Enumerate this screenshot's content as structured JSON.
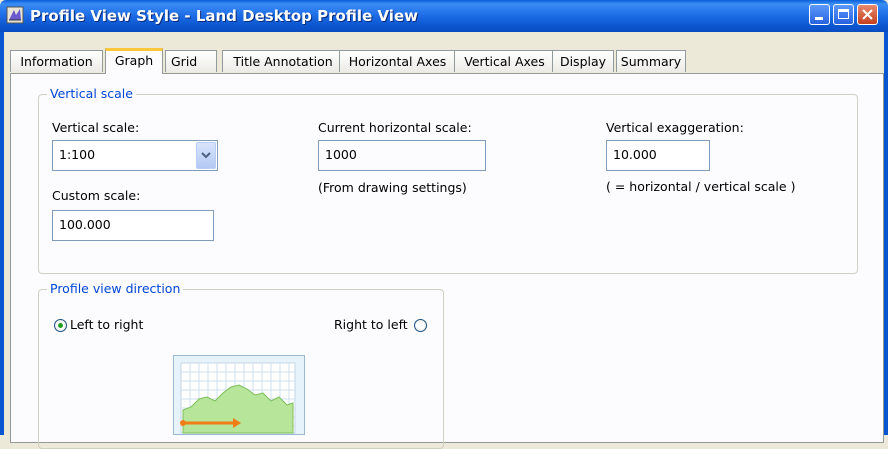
{
  "window": {
    "title": "Profile View Style - Land Desktop Profile View",
    "app_icon": "civil-3d-app-icon"
  },
  "tabs": [
    {
      "label": "Information",
      "active": false
    },
    {
      "label": "Graph",
      "active": true
    },
    {
      "label": "Grid",
      "active": false
    },
    {
      "label": "Title Annotation",
      "active": false
    },
    {
      "label": "Horizontal Axes",
      "active": false
    },
    {
      "label": "Vertical Axes",
      "active": false
    },
    {
      "label": "Display",
      "active": false
    },
    {
      "label": "Summary",
      "active": false
    }
  ],
  "vertical_scale_group": {
    "title": "Vertical scale",
    "vertical_scale_label": "Vertical scale:",
    "vertical_scale_value": "1:100",
    "custom_scale_label": "Custom scale:",
    "custom_scale_value": "100.000",
    "current_horizontal_scale_label": "Current horizontal scale:",
    "current_horizontal_scale_value": "1000",
    "from_drawing_settings_note": "(From drawing settings)",
    "vertical_exaggeration_label": "Vertical exaggeration:",
    "vertical_exaggeration_value": "10.000",
    "exaggeration_formula_note": "( = horizontal / vertical scale )"
  },
  "profile_view_direction_group": {
    "title": "Profile view direction",
    "left_to_right_label": "Left to right",
    "right_to_left_label": "Right to left",
    "selected": "left_to_right"
  },
  "colors": {
    "titlebar": "#0a56d0",
    "group_title": "#0046d5",
    "active_tab_highlight": "#ffc83c",
    "radio_selected": "#21a121",
    "preview_fill": "#b7e59a",
    "preview_arrow": "#f07d16"
  }
}
